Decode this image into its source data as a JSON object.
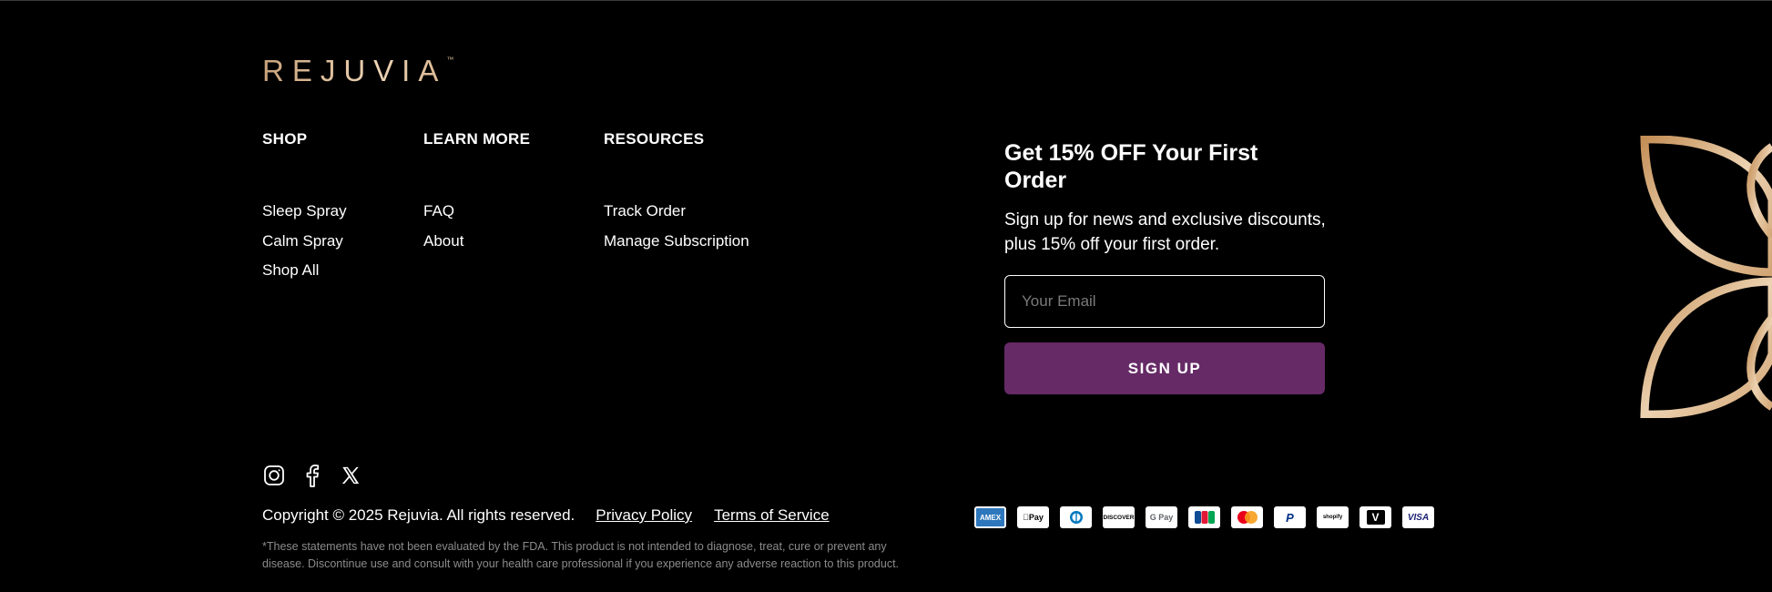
{
  "brand": {
    "logo_text": "REJUVIA",
    "trademark": "™"
  },
  "footer": {
    "columns": [
      {
        "heading": "SHOP",
        "links": [
          "Sleep Spray",
          "Calm Spray",
          "Shop All"
        ]
      },
      {
        "heading": "LEARN MORE",
        "links": [
          "FAQ",
          "About"
        ]
      },
      {
        "heading": "RESOURCES",
        "links": [
          "Track Order",
          "Manage Subscription"
        ]
      }
    ]
  },
  "signup": {
    "title": "Get 15% OFF Your First Order",
    "description": "Sign up for news and exclusive discounts, plus 15% off your first order.",
    "email_placeholder": "Your Email",
    "button_label": "SIGN UP",
    "button_color": "#662a66"
  },
  "social": {
    "icons": [
      "instagram-icon",
      "facebook-icon",
      "x-icon"
    ]
  },
  "legal": {
    "copyright": "Copyright © 2025 Rejuvia. All rights reserved.",
    "privacy": "Privacy Policy",
    "terms": "Terms of Service",
    "disclaimer": "*These statements have not been evaluated by the FDA. This product is not intended to diagnose, treat, cure or prevent any disease. Discontinue use and consult with your health care professional if you experience any adverse reaction to this product."
  },
  "payments": {
    "methods": [
      {
        "name": "amex-icon",
        "label": "AMEX"
      },
      {
        "name": "apple-pay-icon",
        "label": "Pay"
      },
      {
        "name": "diners-club-icon",
        "label": ""
      },
      {
        "name": "discover-icon",
        "label": "DISCOVER"
      },
      {
        "name": "google-pay-icon",
        "label": "G Pay"
      },
      {
        "name": "jcb-icon",
        "label": "JCB"
      },
      {
        "name": "mastercard-icon",
        "label": ""
      },
      {
        "name": "paypal-icon",
        "label": "P"
      },
      {
        "name": "shop-pay-icon",
        "label": "shopify"
      },
      {
        "name": "venmo-icon",
        "label": "V"
      },
      {
        "name": "visa-icon",
        "label": "VISA"
      }
    ]
  },
  "colors": {
    "background": "#000000",
    "gold_accent": "#d9b58c"
  }
}
